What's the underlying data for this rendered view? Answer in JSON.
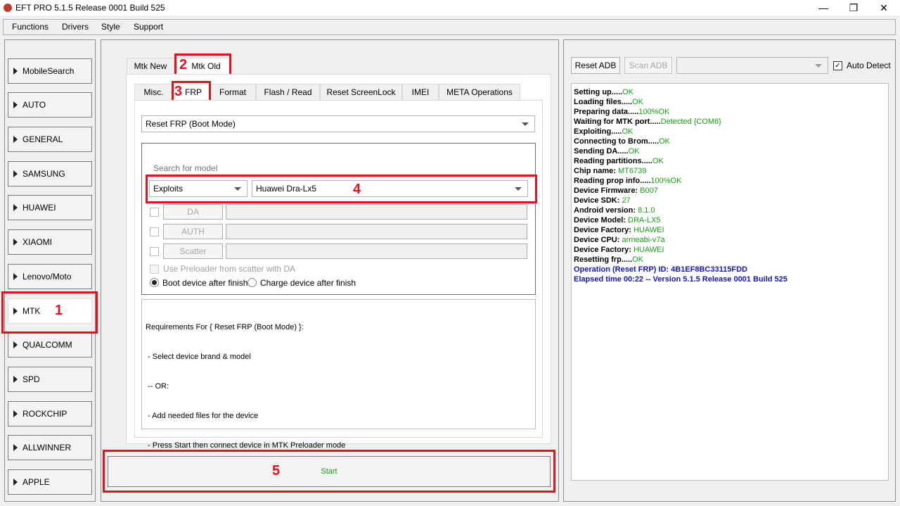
{
  "window": {
    "title": "EFT PRO 5.1.5 Release 0001 Build 525",
    "minimize": "—",
    "restore": "❐",
    "close": "✕"
  },
  "menu": [
    "Functions",
    "Drivers",
    "Style",
    "Support"
  ],
  "sidebar": {
    "items": [
      {
        "label": "MobileSearch"
      },
      {
        "label": "AUTO"
      },
      {
        "label": "GENERAL"
      },
      {
        "label": "SAMSUNG"
      },
      {
        "label": "HUAWEI"
      },
      {
        "label": "XIAOMI"
      },
      {
        "label": "Lenovo/Moto"
      },
      {
        "label": "MTK"
      },
      {
        "label": "QUALCOMM"
      },
      {
        "label": "SPD"
      },
      {
        "label": "ROCKCHIP"
      },
      {
        "label": "ALLWINNER"
      },
      {
        "label": "APPLE"
      }
    ],
    "selected": "MTK"
  },
  "top_tabs": [
    "Mtk New",
    "Mtk Old"
  ],
  "sub_tabs": [
    "Misc.",
    "FRP",
    "Format",
    "Flash / Read",
    "Reset ScreenLock",
    "IMEI",
    "META Operations"
  ],
  "frp": {
    "mode_select": "Reset FRP (Boot Mode)",
    "search_placeholder": "Search for model",
    "method_select": "Exploits",
    "model_select": "Huawei Dra-Lx5",
    "file_buttons": [
      "DA",
      "AUTH",
      "Scatter"
    ],
    "use_preloader": "Use Preloader from scatter with DA",
    "radio_boot": "Boot device after finish",
    "radio_charge": "Charge device after finish",
    "requirements": [
      "Requirements For { Reset FRP (Boot Mode) }:",
      " - Select device brand & model",
      " -- OR:",
      " - Add needed files for the device",
      " - Press Start then connect device in MTK Preloader mode"
    ]
  },
  "start_label": "Start",
  "annotations": [
    "1",
    "2",
    "3",
    "4",
    "5"
  ],
  "adb": {
    "reset_label": "Reset ADB",
    "scan_label": "Scan ADB",
    "auto_detect": "Auto Detect"
  },
  "log": [
    {
      "k": "Setting up.....",
      "v": "OK"
    },
    {
      "k": "Loading files.....",
      "v": "OK"
    },
    {
      "k": "Preparing data.....",
      "v": "100%OK"
    },
    {
      "k": "Waiting for MTK port.....",
      "v": "Detected {COM6}"
    },
    {
      "k": "Exploiting.....",
      "v": "OK"
    },
    {
      "k": "Connecting to Brom.....",
      "v": "OK"
    },
    {
      "k": "Sending DA.....",
      "v": "OK"
    },
    {
      "k": "Reading partitions.....",
      "v": "OK"
    },
    {
      "k": "Chip name: ",
      "v": "MT6739"
    },
    {
      "k": "Reading prop info.....",
      "v": "100%OK"
    },
    {
      "k": "Device Firmware: ",
      "v": "B007"
    },
    {
      "k": "Device SDK: ",
      "v": "27"
    },
    {
      "k": "Android version: ",
      "v": "8.1.0"
    },
    {
      "k": "Device Model: ",
      "v": "DRA-LX5"
    },
    {
      "k": "Device Factory: ",
      "v": "HUAWEI"
    },
    {
      "k": "Device CPU: ",
      "v": "armeabi-v7a"
    },
    {
      "k": "Device Factory: ",
      "v": "HUAWEI"
    },
    {
      "k": "Resetting frp.....",
      "v": "OK"
    },
    {
      "blue": "Operation (Reset FRP) ID: 4B1EF8BC33115FDD"
    },
    {
      "blue": "Elapsed time 00:22 -- Version 5.1.5 Release 0001 Build 525"
    }
  ],
  "colors": {
    "annotation_red": "#e3121c",
    "ok_green": "#14a014",
    "info_blue": "#1414c8"
  }
}
